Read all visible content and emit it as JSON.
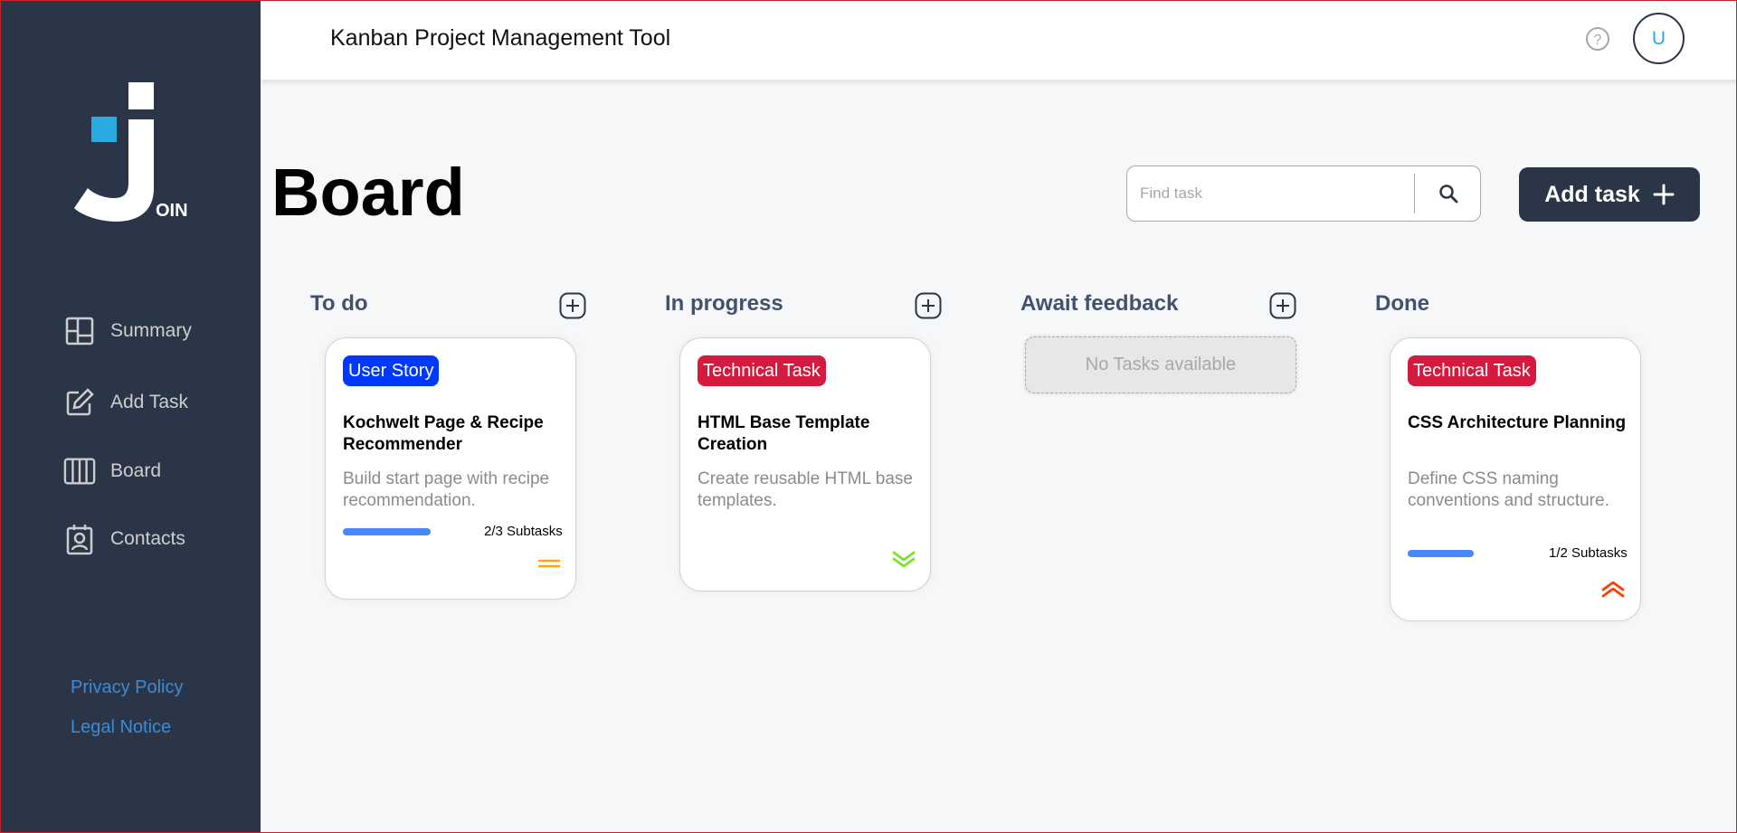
{
  "app": {
    "title": "Kanban Project Management Tool"
  },
  "logo": {
    "text": "OIN"
  },
  "sidebar": {
    "items": [
      {
        "label": "Summary",
        "icon": "summary-icon"
      },
      {
        "label": "Add Task",
        "icon": "add-task-icon"
      },
      {
        "label": "Board",
        "icon": "board-icon"
      },
      {
        "label": "Contacts",
        "icon": "contacts-icon"
      }
    ],
    "footer": {
      "privacy": "Privacy Policy",
      "legal": "Legal Notice"
    }
  },
  "header": {
    "help_icon": "help-icon",
    "avatar_initial": "U"
  },
  "board": {
    "title": "Board",
    "search_placeholder": "Find task",
    "add_task_label": "Add task",
    "columns": [
      {
        "title": "To do"
      },
      {
        "title": "In progress"
      },
      {
        "title": "Await feedback",
        "empty_text": "No Tasks available"
      },
      {
        "title": "Done"
      }
    ]
  },
  "cards": [
    {
      "category": "User Story",
      "category_color": "#0038FF",
      "title": "Kochwelt Page & Recipe Recommender",
      "description": "Build start page with recipe recommendation.",
      "subtasks_text": "2/3 Subtasks",
      "subtasks_done": 2,
      "subtasks_total": 3,
      "priority": "medium",
      "priority_color": "#FFA800"
    },
    {
      "category": "Technical Task",
      "category_color": "#D41B3F",
      "title": "HTML Base Template Creation",
      "description": "Create reusable HTML base templates.",
      "priority": "low",
      "priority_color": "#7AE229"
    },
    {
      "category": "Technical Task",
      "category_color": "#D41B3F",
      "title": "CSS Architecture Planning",
      "description": "Define CSS naming conventions and structure.",
      "subtasks_text": "1/2 Subtasks",
      "subtasks_done": 1,
      "subtasks_total": 2,
      "priority": "urgent",
      "priority_color": "#FF3D00"
    }
  ],
  "colors": {
    "sidebar_bg": "#2A3647",
    "accent": "#29ABE2",
    "progress": "#4589FF",
    "page_bg": "#F6F7F8"
  }
}
